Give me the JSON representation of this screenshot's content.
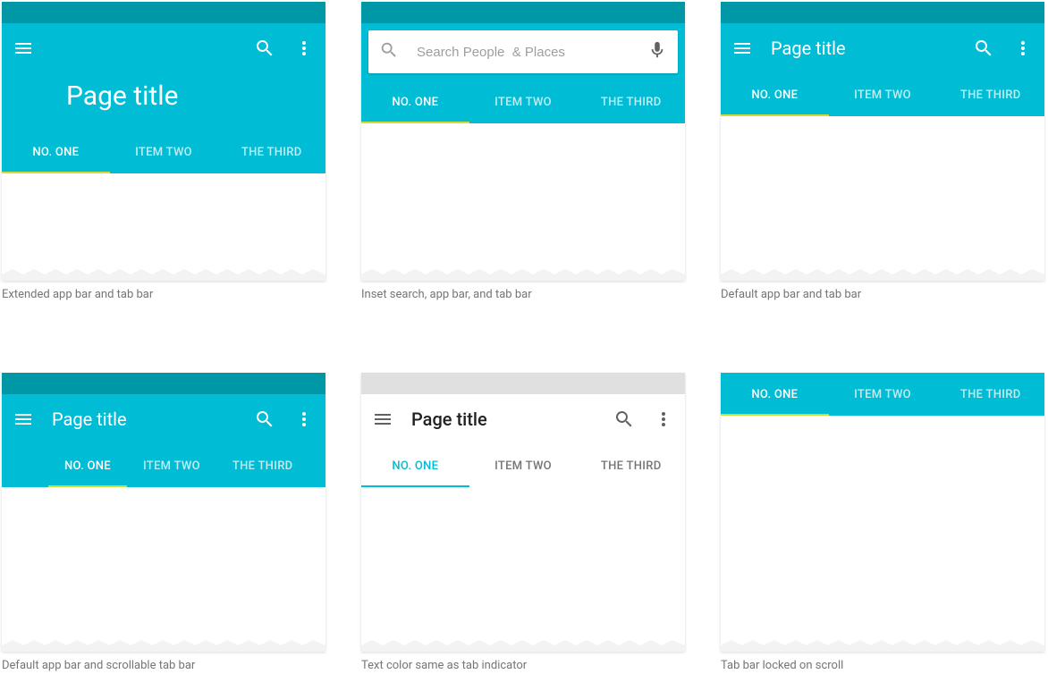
{
  "colors": {
    "primary": "#00bcd4",
    "primary_dark": "#0097a7",
    "accent": "#cddc39"
  },
  "tabs": [
    "NO. ONE",
    "ITEM TWO",
    "THE THIRD"
  ],
  "active_tab_index": 0,
  "cards": [
    {
      "id": "extended",
      "title": "Page title",
      "caption": "Extended app bar and tab bar"
    },
    {
      "id": "inset_search",
      "search_placeholder": "Search People  & Places",
      "caption": "Inset search, app bar, and tab bar"
    },
    {
      "id": "default",
      "title": "Page title",
      "caption": "Default app bar and tab bar"
    },
    {
      "id": "scrollable",
      "title": "Page title",
      "caption": "Default app bar and scrollable tab bar"
    },
    {
      "id": "text_indicator",
      "title": "Page title",
      "caption": "Text color same as tab indicator"
    },
    {
      "id": "locked",
      "caption": "Tab bar locked on scroll"
    }
  ]
}
